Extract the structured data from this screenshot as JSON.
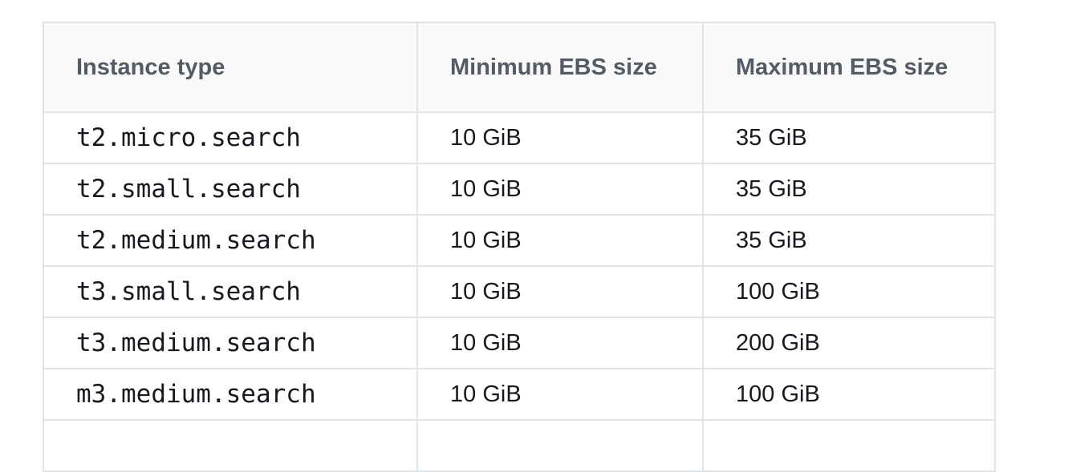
{
  "table": {
    "headers": [
      "Instance type",
      "Minimum EBS size",
      "Maximum EBS size"
    ],
    "rows": [
      [
        "t2.micro.search",
        "10 GiB",
        "35 GiB"
      ],
      [
        "t2.small.search",
        "10 GiB",
        "35 GiB"
      ],
      [
        "t2.medium.search",
        "10 GiB",
        "35 GiB"
      ],
      [
        "t3.small.search",
        "10 GiB",
        "100 GiB"
      ],
      [
        "t3.medium.search",
        "10 GiB",
        "200 GiB"
      ],
      [
        "m3.medium.search",
        "10 GiB",
        "100 GiB"
      ]
    ]
  }
}
